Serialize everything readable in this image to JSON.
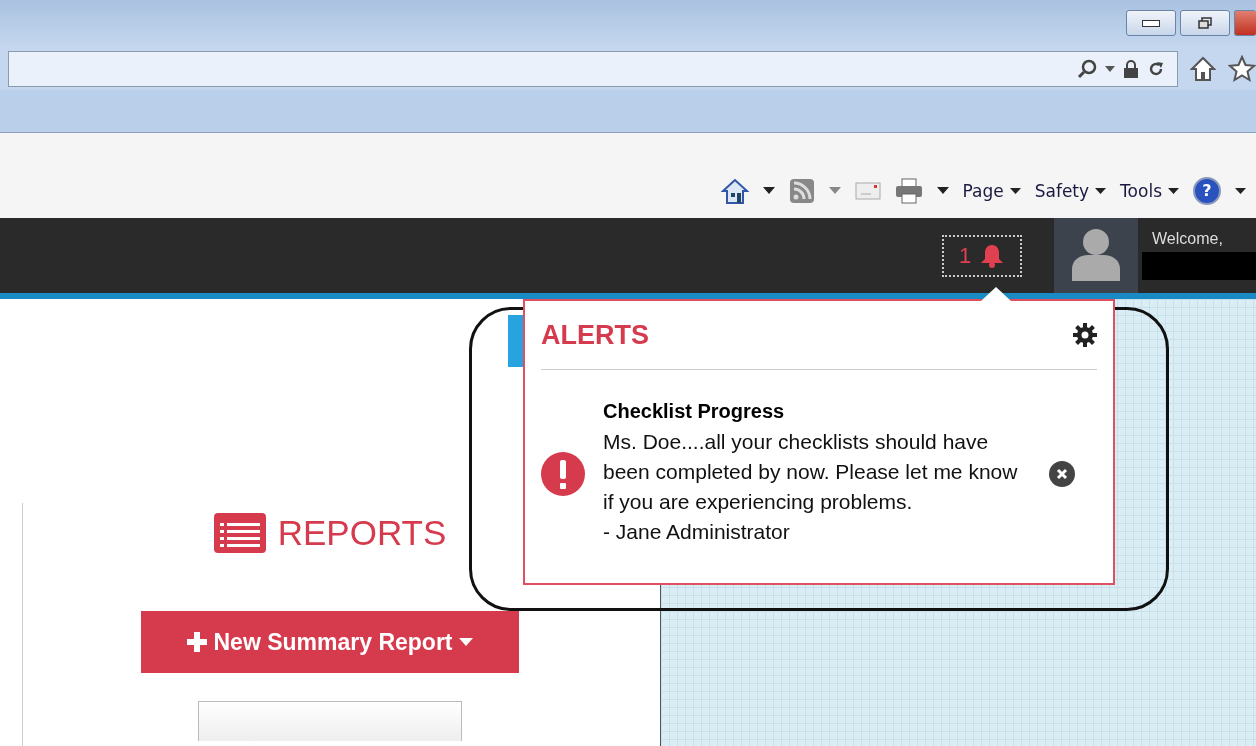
{
  "command_bar": {
    "menus": [
      {
        "label": "Page"
      },
      {
        "label": "Safety"
      },
      {
        "label": "Tools"
      }
    ]
  },
  "help": {
    "glyph": "?"
  },
  "nav": {
    "alert_count": "1",
    "welcome": "Welcome,"
  },
  "alerts": {
    "title": "ALERTS",
    "items": [
      {
        "title": "Checklist Progress",
        "message": "Ms. Doe....all your checklists should have been completed by now. Please let me know if you are experiencing problems.",
        "signature": "- Jane Administrator"
      }
    ]
  },
  "reports": {
    "heading": "REPORTS",
    "new_button": "New Summary Report"
  }
}
